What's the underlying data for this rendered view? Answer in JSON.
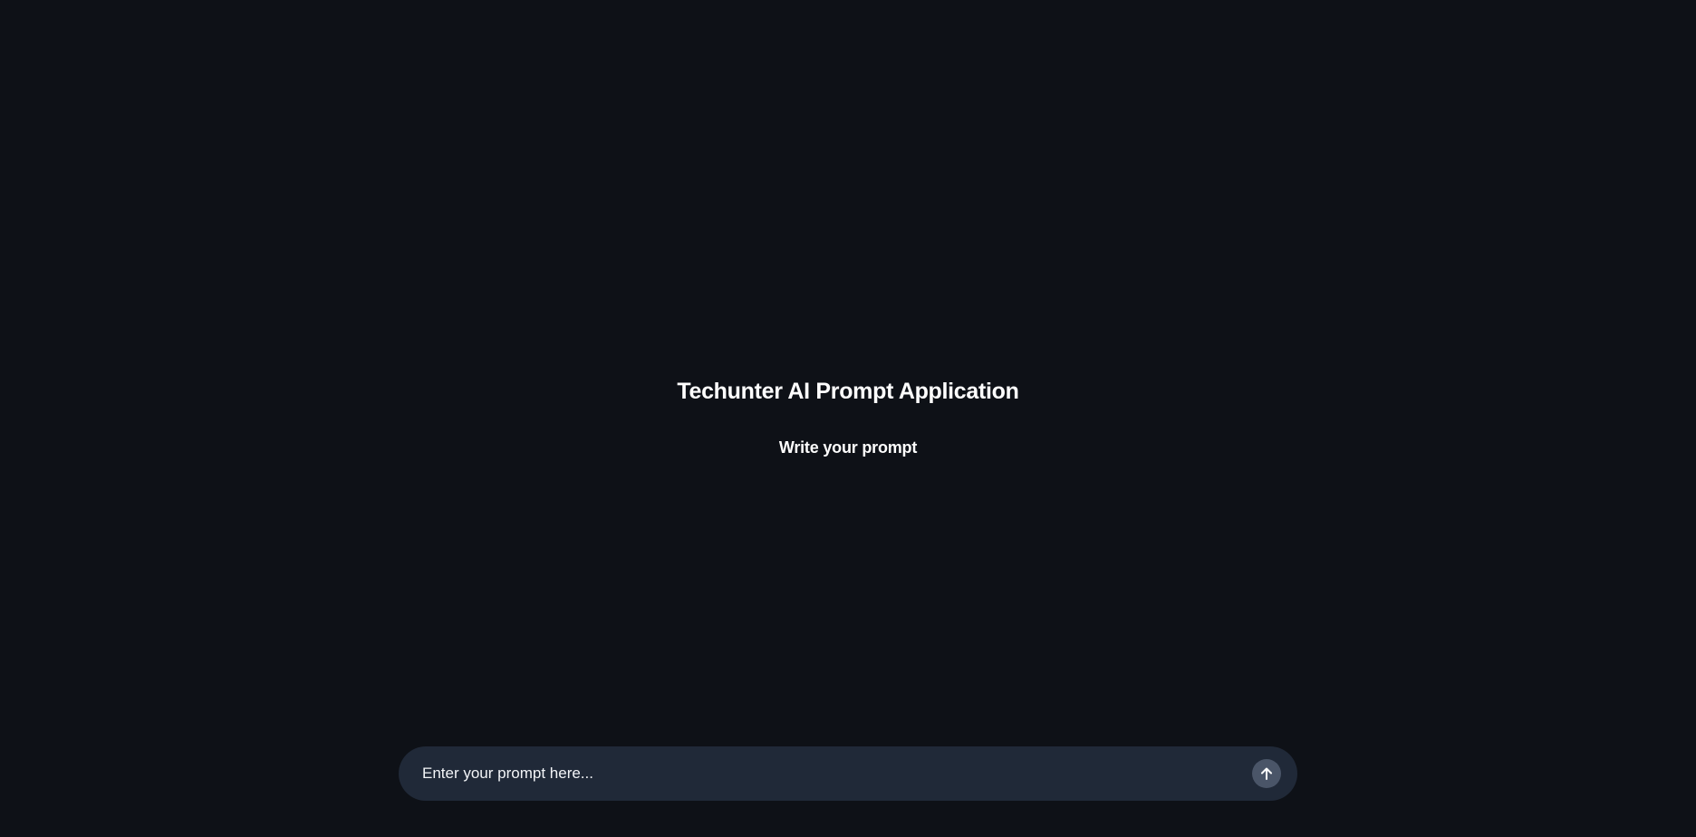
{
  "header": {
    "title": "Techunter AI Prompt Application",
    "subtitle": "Write your prompt"
  },
  "prompt": {
    "placeholder": "Enter your prompt here...",
    "value": "",
    "send_icon": "arrow-up-icon"
  },
  "colors": {
    "background": "#0e1117",
    "input_background": "#202938",
    "send_button": "#4a5568",
    "text": "#ffffff"
  }
}
